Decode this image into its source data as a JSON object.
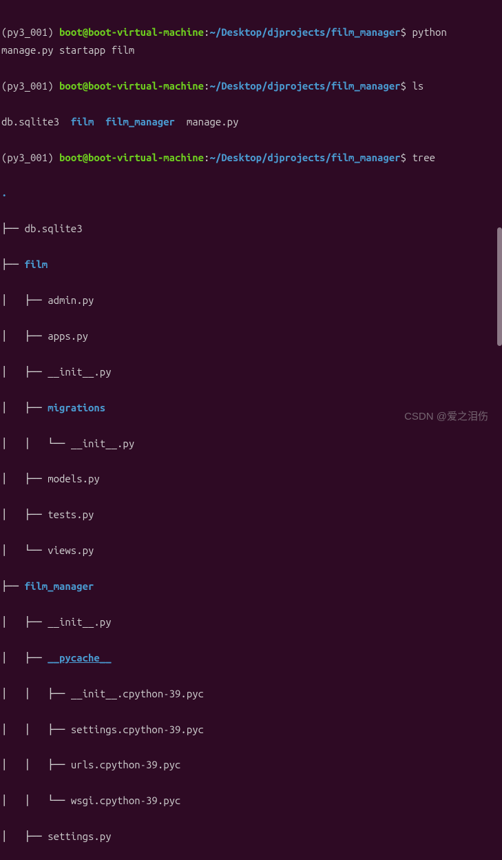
{
  "prompt": {
    "env": "(py3_001)",
    "user_host": "boot@boot-virtual-machine",
    "path": "~/Desktop/djprojects/film_manager",
    "symbol": "$"
  },
  "commands": {
    "c1": "python manage.py startapp film",
    "c2": "ls",
    "c3": "tree"
  },
  "ls_output": {
    "f1": "db.sqlite3",
    "d1": "film",
    "d2": "film_manager",
    "f2": "manage.py"
  },
  "tree": {
    "root": ".",
    "n1": "db.sqlite3",
    "n2": "film",
    "n2_1": "admin.py",
    "n2_2": "apps.py",
    "n2_3": "__init__.py",
    "n2_4": "migrations",
    "n2_4_1": "__init__.py",
    "n2_5": "models.py",
    "n2_6": "tests.py",
    "n2_7": "views.py",
    "n3": "film_manager",
    "n3_1": "__init__.py",
    "n3_2": "__pycache__",
    "n3_2_1": "__init__.cpython-39.pyc",
    "n3_2_2": "settings.cpython-39.pyc",
    "n3_2_3": "urls.cpython-39.pyc",
    "n3_2_4": "wsgi.cpython-39.pyc",
    "n3_3": "settings.py"
  },
  "tree_prefix": {
    "p_l1": "├── ",
    "p_l2a": "│   ├── ",
    "p_l2b": "│   │   ├── ",
    "p_l2c": "│   │   └── ",
    "p_l2d": "│   └── ",
    "p_l3a": "│   │   ├── ",
    "p_l3b": "│   │   └── "
  },
  "watermark": "CSDN @爱之泪伤"
}
